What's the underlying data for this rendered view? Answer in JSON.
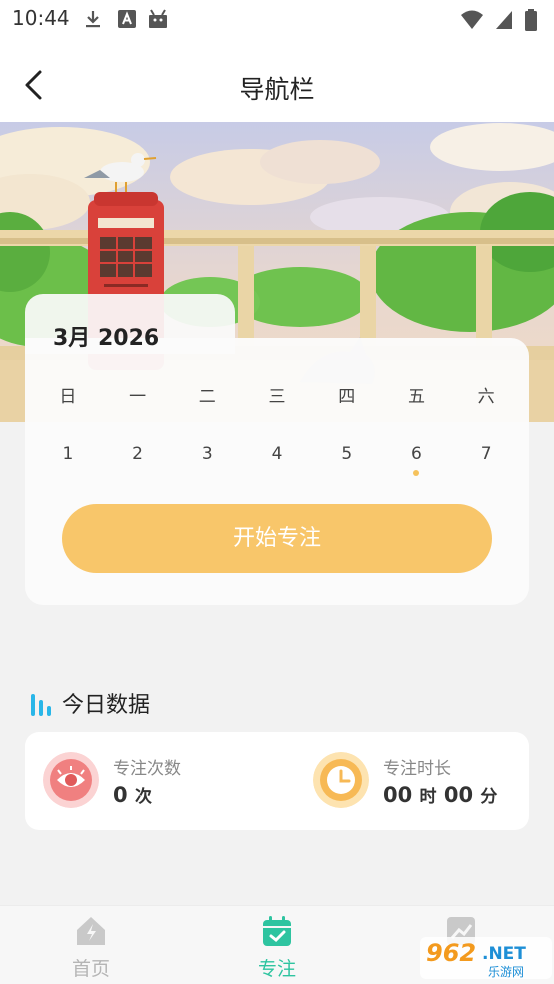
{
  "status_bar": {
    "time": "10:44"
  },
  "nav": {
    "title": "导航栏"
  },
  "calendar": {
    "month_label": "3月 2026",
    "weekdays": [
      "日",
      "一",
      "二",
      "三",
      "四",
      "五",
      "六"
    ],
    "dates": [
      "1",
      "2",
      "3",
      "4",
      "5",
      "6",
      "7"
    ],
    "marked_index": 5,
    "start_button": "开始专注",
    "accent": "#f8c66a"
  },
  "today": {
    "title": "今日数据",
    "focus_count": {
      "label": "专注次数",
      "value": "0",
      "unit": "次"
    },
    "focus_duration": {
      "label": "专注时长",
      "hours": "00",
      "hours_unit": "时",
      "minutes": "00",
      "minutes_unit": "分"
    }
  },
  "tabbar": {
    "items": [
      {
        "label": "首页",
        "icon": "home-icon",
        "active": false
      },
      {
        "label": "专注",
        "icon": "calendar-check-icon",
        "active": true
      },
      {
        "label": "",
        "icon": "chart-icon",
        "active": false
      }
    ],
    "active_color": "#2ec4a0"
  },
  "watermark": {
    "text": "962.NET",
    "sub": "乐游网"
  }
}
